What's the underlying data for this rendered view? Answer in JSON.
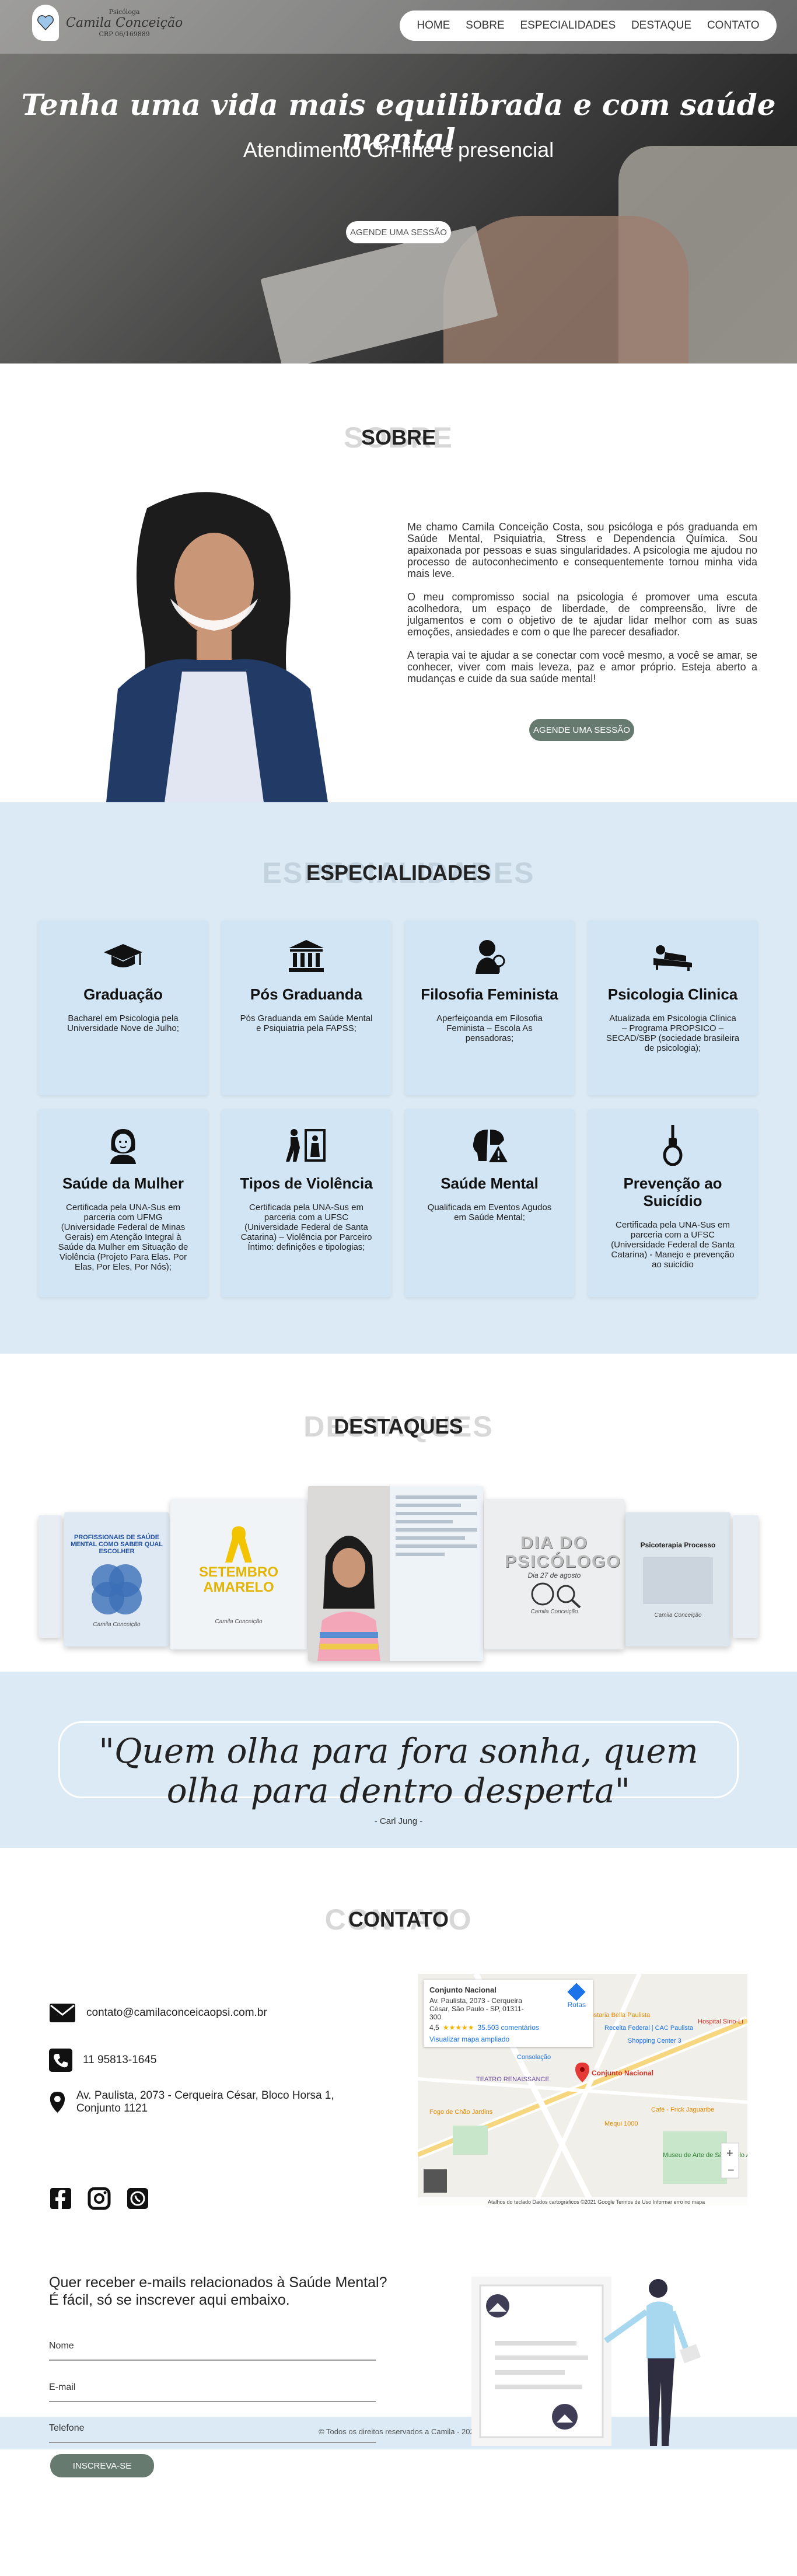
{
  "nav": {
    "logo_small": "Psicóloga",
    "logo_name": "Camila Conceição",
    "logo_crp": "CRP 06/169889",
    "items": [
      "HOME",
      "SOBRE",
      "ESPECIALIDADES",
      "DESTAQUE",
      "CONTATO"
    ]
  },
  "hero": {
    "title": "Tenha uma vida mais equilibrada e com saúde mental",
    "subtitle": "Atendimento On-line e presencial",
    "button": "AGENDE UMA SESSÃO"
  },
  "sobre": {
    "title": "SOBRE",
    "paragraphs": [
      "Me chamo Camila Conceição Costa, sou psicóloga e pós graduanda em Saúde Mental, Psiquiatria, Stress e Dependencia Química. Sou apaixonada por pessoas e suas singularidades. A psicologia me ajudou no processo de autoconhecimento e consequentemente tornou minha vida mais leve.",
      "O meu compromisso social na psicologia é promover uma escuta acolhedora, um espaço de liberdade, de compreensão, livre de julgamentos e com o objetivo de te ajudar lidar melhor com as suas emoções, ansiedades e com o que lhe parecer desafiador.",
      "A terapia vai te ajudar a se conectar com você mesmo, a você se amar, se conhecer, viver com mais leveza, paz e amor próprio. Esteja aberto a mudanças e cuide da sua saúde mental!"
    ],
    "button": "AGENDE UMA SESSÃO"
  },
  "especialidades": {
    "title": "ESPECIALIDADES",
    "cards": [
      {
        "icon": "graduation-cap-icon",
        "title": "Graduação",
        "text": "Bacharel em Psicologia pela Universidade Nove de Julho;"
      },
      {
        "icon": "university-icon",
        "title": "Pós Graduanda",
        "text": "Pós Graduanda em Saúde Mental e Psiquiatria pela FAPSS;"
      },
      {
        "icon": "feminist-icon",
        "title": "Filosofia Feminista",
        "text": "Aperfeiçoanda em Filosofia Feminista – Escola As pensadoras;"
      },
      {
        "icon": "couch-patient-icon",
        "title": "Psicologia Clinica",
        "text": "Atualizada em Psicologia Clínica – Programa PROPSICO – SECAD/SBP (sociedade brasileira de psicologia);"
      },
      {
        "icon": "woman-icon",
        "title": "Saúde da Mulher",
        "text": "Certificada pela UNA-Sus em parceria com UFMG (Universidade Federal de Minas Gerais) em Atenção Integral à Saúde da Mulher em Situação de Violência (Projeto Para Elas. Por Elas, Por Eles, Por Nós);"
      },
      {
        "icon": "violence-icon",
        "title": "Tipos de Violência",
        "text": "Certificada pela UNA-Sus em parceria com a UFSC (Universidade Federal de Santa Catarina) – Violência por Parceiro Íntimo: definições e tipologias;"
      },
      {
        "icon": "brain-warning-icon",
        "title": "Saúde Mental",
        "text": "Qualificada em Eventos Agudos em Saúde Mental;"
      },
      {
        "icon": "noose-icon",
        "title": "Prevenção ao Suicídio",
        "text": "Certificada pela UNA-Sus em parceria com a UFSC (Universidade Federal de Santa Catarina) - Manejo e prevenção ao suicídio"
      }
    ]
  },
  "destaques": {
    "title": "DESTAQUES",
    "slides": [
      {
        "title": "PROFISSIONAIS DE SAÚDE MENTAL COMO SABER QUAL ESCOLHER",
        "sig": "Camila Conceição"
      },
      {
        "title": "SETEMBRO AMARELO",
        "sig": "Camila Conceição"
      },
      {
        "title": "",
        "sig": ""
      },
      {
        "title": "DIA DO PSICÓLOGO",
        "sub": "Dia 27 de agosto",
        "sig": "Camila Conceição"
      },
      {
        "title": "Psicoterapia Processo",
        "sig": "Camila Conceição"
      }
    ]
  },
  "quote": {
    "text": "\"Quem olha para fora sonha, quem olha para dentro desperta\"",
    "author": "- Carl Jung -"
  },
  "contato": {
    "title": "CONTATO",
    "email": "contato@camilaconceicaopsi.com.br",
    "phone": "11 95813-1645",
    "address": "Av. Paulista, 2073 - Cerqueira César, Bloco Horsa 1, Conjunto 1121",
    "map": {
      "place": "Conjunto Nacional",
      "address": "Av. Paulista, 2073 - Cerqueira César, São Paulo - SP, 01311-300",
      "rating": "4,5",
      "reviews": "35.503 comentários",
      "larger": "Visualizar mapa ampliado",
      "routes": "Rotas",
      "pin_label": "Conjunto Nacional",
      "labels": [
        "Tostaria Bella Paulista",
        "Receita Federal | CAC Paulista",
        "Hospital Sírio-Li",
        "Shopping Center 3",
        "Consolação",
        "TEATRO RENAISSANCE",
        "Fogo de Chão Jardins",
        "Mequi 1000",
        "Museu de Arte de São Paulo Assis...",
        "Café - Frick Jaguaribe"
      ],
      "footer": "Atalhos do teclado   Dados cartográficos ©2021 Google   Termos de Uso   Informar erro no mapa"
    },
    "news_question_1": "Quer receber e-mails relacionados à Saúde Mental?",
    "news_question_2": "É fácil, só se inscrever aqui embaixo.",
    "fields": [
      "Nome",
      "E-mail",
      "Telefone"
    ],
    "news_button": "INSCREVA-SE"
  },
  "footer": {
    "text": "© Todos os direitos reservados a Camila - 2021"
  },
  "colors": {
    "accent_blue": "#dbeaf5",
    "button_green": "#667a70",
    "pin_red": "#e53935"
  }
}
